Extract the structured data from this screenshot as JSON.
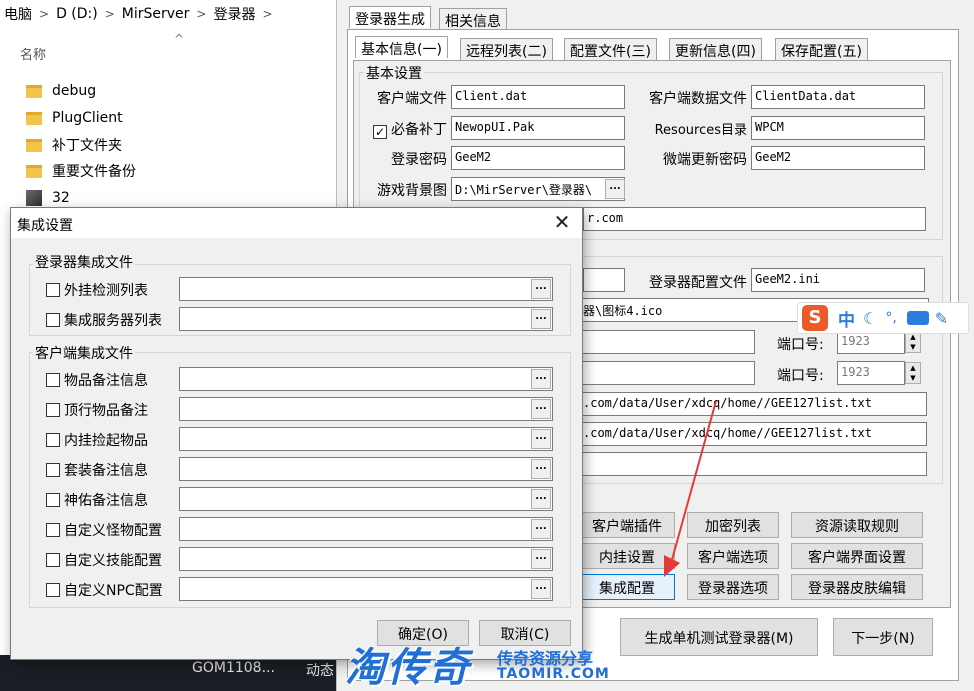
{
  "explorer": {
    "breadcrumb": [
      "电脑",
      "D (D:)",
      "MirServer",
      "登录器"
    ],
    "column_header": "名称",
    "items": [
      {
        "name": "debug",
        "type": "folder"
      },
      {
        "name": "PlugClient",
        "type": "folder"
      },
      {
        "name": "补丁文件夹",
        "type": "folder"
      },
      {
        "name": "重要文件备份",
        "type": "folder"
      },
      {
        "name": "32",
        "type": "file"
      }
    ],
    "taskbar_label": "GOM1108...",
    "taskbar_label2": "动态"
  },
  "main": {
    "top_tabs": [
      "登录器生成",
      "相关信息"
    ],
    "sub_tabs": [
      "基本信息(一)",
      "远程列表(二)",
      "配置文件(三)",
      "更新信息(四)",
      "保存配置(五)"
    ],
    "basic": {
      "group_title": "基本设置",
      "client_file_label": "客户端文件",
      "client_file_value": "Client.dat",
      "client_data_label": "客户端数据文件",
      "client_data_value": "ClientData.dat",
      "patch_label": "必备补丁",
      "patch_checked": "✓",
      "patch_value": "NewopUI.Pak",
      "resources_label": "Resources目录",
      "resources_value": "WPCM",
      "login_pwd_label": "登录密码",
      "login_pwd_value": "GeeM2",
      "micro_pwd_label": "微端更新密码",
      "micro_pwd_value": "GeeM2",
      "bg_label": "游戏背景图",
      "bg_value": "D:\\MirServer\\登录器\\",
      "url_partial": "r.com"
    },
    "config": {
      "login_config_label": "登录器配置文件",
      "login_config_value": "GeeM2.ini",
      "icon_value": "器\\图标4.ico",
      "port_label": "端口号:",
      "port1": "1923",
      "port2": "1923",
      "list_url1": ".com/data/User/xdcq/home//GEE127list.txt",
      "list_url2": ".com/data/User/xdcq/home//GEE127list.txt"
    },
    "buttons": {
      "client_plugin": "客户端插件",
      "encrypt_list": "加密列表",
      "resource_rule": "资源读取规则",
      "inner_hook": "内挂设置",
      "client_options": "客户端选项",
      "client_ui": "客户端界面设置",
      "integration": "集成配置",
      "login_options": "登录器选项",
      "login_skin": "登录器皮肤编辑",
      "generate_test": "生成单机测试登录器(M)",
      "next_step": "下一步(N)"
    }
  },
  "dialog": {
    "title": "集成设置",
    "close_glyph": "✕",
    "group1_title": "登录器集成文件",
    "group1_items": [
      "外挂检测列表",
      "集成服务器列表"
    ],
    "group2_title": "客户端集成文件",
    "group2_items": [
      "物品备注信息",
      "顶行物品备注",
      "内挂捡起物品",
      "套装备注信息",
      "神佑备注信息",
      "自定义怪物配置",
      "自定义技能配置",
      "自定义NPC配置"
    ],
    "dots_glyph": "...",
    "ok": "确定(O)",
    "cancel": "取消(C)"
  },
  "ime": {
    "logo_letter": "S",
    "mode": "中",
    "icons": [
      "moon-icon",
      "punctuation-icon",
      "keyboard-icon",
      "wrench-icon"
    ]
  },
  "watermark": {
    "brand": "淘传奇",
    "slogan": "传奇资源分享",
    "url": "TAOMIR.COM"
  },
  "colors": {
    "accent": "#0078d7",
    "watermark": "#1f6fd6",
    "arrow": "#e43a3a",
    "sogou": "#ec5a27"
  }
}
